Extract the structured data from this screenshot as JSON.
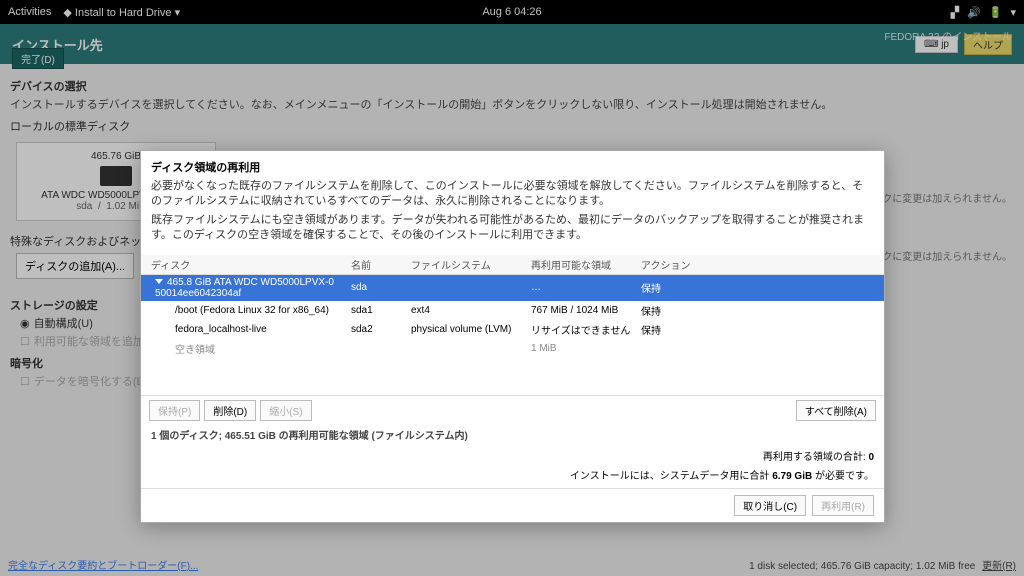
{
  "topbar": {
    "activities": "Activities",
    "app": "Install to Hard Drive",
    "clock": "Aug 6  04:26"
  },
  "header": {
    "title": "インストール先",
    "subtitle": "FEDORA 32 のインストール",
    "done": "完了(D)",
    "kb": "jp",
    "help": "ヘルプ"
  },
  "device_sel": {
    "title": "デバイスの選択",
    "desc": "インストールするデバイスを選択してください。なお、メインメニューの「インストールの開始」ボタンをクリックしない限り、インストール処理は開始されません。",
    "local_title": "ローカルの標準ディスク",
    "disk": {
      "capacity": "465.76 GiB",
      "name": "ATA WDC WD5000LPVX-0 500…",
      "dev": "sda",
      "sep": "/",
      "free": "1.02 MiB…"
    },
    "right_note1": "…のディスクに変更は加えられません。",
    "special_title": "特殊なディスクおよびネットワークディス…",
    "add_disk": "ディスクの追加(A)...",
    "right_note2": "…のディスクに変更は加えられません。"
  },
  "storage": {
    "title": "ストレージの設定",
    "auto": "自動構成(U)",
    "addspace": "利用可能な領域を追加する(M)",
    "enc_title": "暗号化",
    "enc_opt": "データを暗号化する(E) パスフレー…"
  },
  "dialog": {
    "title": "ディスク領域の再利用",
    "p1": "必要がなくなった既存のファイルシステムを削除して、このインストールに必要な領域を解放してください。ファイルシステムを削除すると、そのファイルシステムに収納されているすべてのデータは、永久に削除されることになります。",
    "p2": "既存ファイルシステムにも空き領域があります。データが失われる可能性があるため、最初にデータのバックアップを取得することが推奨されます。このディスクの空き領域を確保することで、その後のインストールに利用できます。",
    "cols": {
      "disk": "ディスク",
      "name": "名前",
      "fs": "ファイルシステム",
      "recl": "再利用可能な領域",
      "act": "アクション"
    },
    "rows": [
      {
        "indent": 0,
        "disk": "465.8 GiB ATA WDC WD5000LPVX-0 50014ee6042304af",
        "name": "sda",
        "fs": "",
        "recl": "…",
        "act": "保持",
        "selected": true
      },
      {
        "indent": 1,
        "disk": "/boot (Fedora Linux 32 for x86_64)",
        "name": "sda1",
        "fs": "ext4",
        "recl": "767 MiB / 1024 MiB",
        "act": "保持"
      },
      {
        "indent": 1,
        "disk": "fedora_localhost-live",
        "name": "sda2",
        "fs": "physical volume (LVM)",
        "recl": "リサイズはできません",
        "act": "保持"
      },
      {
        "indent": 1,
        "disk": "空き領域",
        "name": "",
        "fs": "",
        "recl": "1 MiB",
        "act": ""
      }
    ],
    "btn_keep": "保持(P)",
    "btn_delete": "削除(D)",
    "btn_shrink": "縮小(S)",
    "btn_delete_all": "すべて削除(A)",
    "summary": "1 個のディスク; 465.51 GiB の再利用可能な領域 (ファイルシステム内)",
    "total_label": "再利用する領域の合計:",
    "total_val": "0",
    "req_pre": "インストールには、システムデータ用に合計 ",
    "req_val": "6.79 GiB",
    "req_post": " が必要です。",
    "cancel": "取り消し(C)",
    "reclaim": "再利用(R)"
  },
  "footer": {
    "link": "完全なディスク要約とブートローダー(F)...",
    "status": "1 disk selected; 465.76 GiB capacity; 1.02 MiB free",
    "refresh": "更新(R)"
  }
}
